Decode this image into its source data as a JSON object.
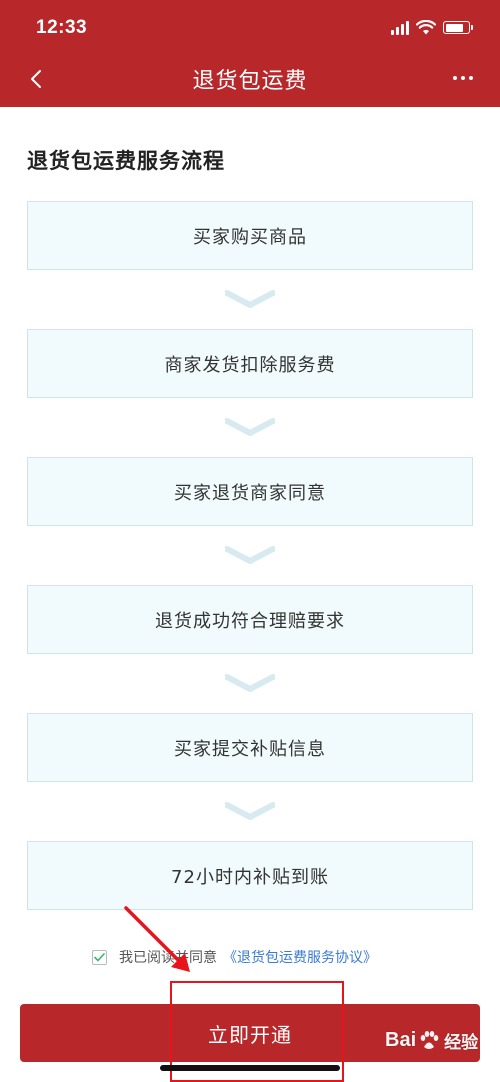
{
  "status_bar": {
    "time": "12:33"
  },
  "nav": {
    "title": "退货包运费"
  },
  "section_title": "退货包运费服务流程",
  "steps": [
    {
      "label": "买家购买商品"
    },
    {
      "label": "商家发货扣除服务费"
    },
    {
      "label": "买家退货商家同意"
    },
    {
      "label": "退货成功符合理赔要求"
    },
    {
      "label": "买家提交补贴信息"
    },
    {
      "label": "72小时内补贴到账"
    }
  ],
  "agreement": {
    "checked": true,
    "prefix": "我已阅读并同意",
    "link_text": "《退货包运费服务协议》"
  },
  "cta": {
    "label": "立即开通"
  },
  "watermark": {
    "brand": "Bai",
    "suffix": "经验"
  },
  "colors": {
    "brand_red": "#b8282b",
    "step_bg": "#f1fbfd",
    "arrow": "#d6eaf0",
    "link": "#3a7bd5",
    "annotation_red": "#e8141c"
  },
  "icons": {
    "back": "chevron-left-icon",
    "more": "more-dots-icon",
    "step_arrow": "chevron-down-icon",
    "check": "check-icon"
  }
}
